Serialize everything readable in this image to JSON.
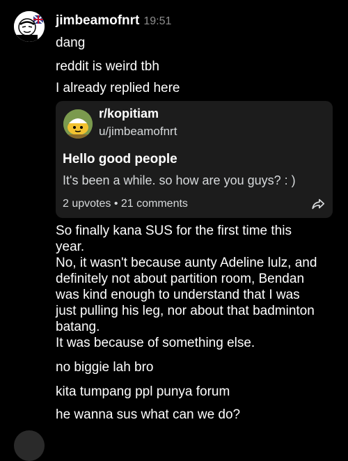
{
  "message_group": {
    "username": "jimbeamofnrt",
    "timestamp": "19:51"
  },
  "messages": {
    "m1": "dang",
    "m2": "reddit is weird tbh",
    "m3": "I already replied here",
    "m5": "no biggie lah bro",
    "m6": "kita tumpang ppl punya forum",
    "m7": "he wanna sus what can we do?"
  },
  "shared_post": {
    "subreddit": "r/kopitiam",
    "author": "u/jimbeamofnrt",
    "title": "Hello good people",
    "body": "It's been a while. so how are you guys? : )",
    "stats": "2 upvotes • 21 comments",
    "share_icon": "share-arrow-icon"
  },
  "long_message": {
    "lines": [
      "So finally kana SUS for the first time this",
      "year.",
      "No, it wasn't because aunty Adeline lulz, and",
      "definitely not about partition room, Bendan",
      "was kind enough to understand that I was",
      "just pulling his leg, nor about that badminton",
      "batang.",
      "It was because of something else."
    ]
  },
  "colors": {
    "background": "#000000",
    "card": "#1c1c1c",
    "timestamp": "#8e8e8e",
    "secondary_text": "#d7dadc"
  }
}
